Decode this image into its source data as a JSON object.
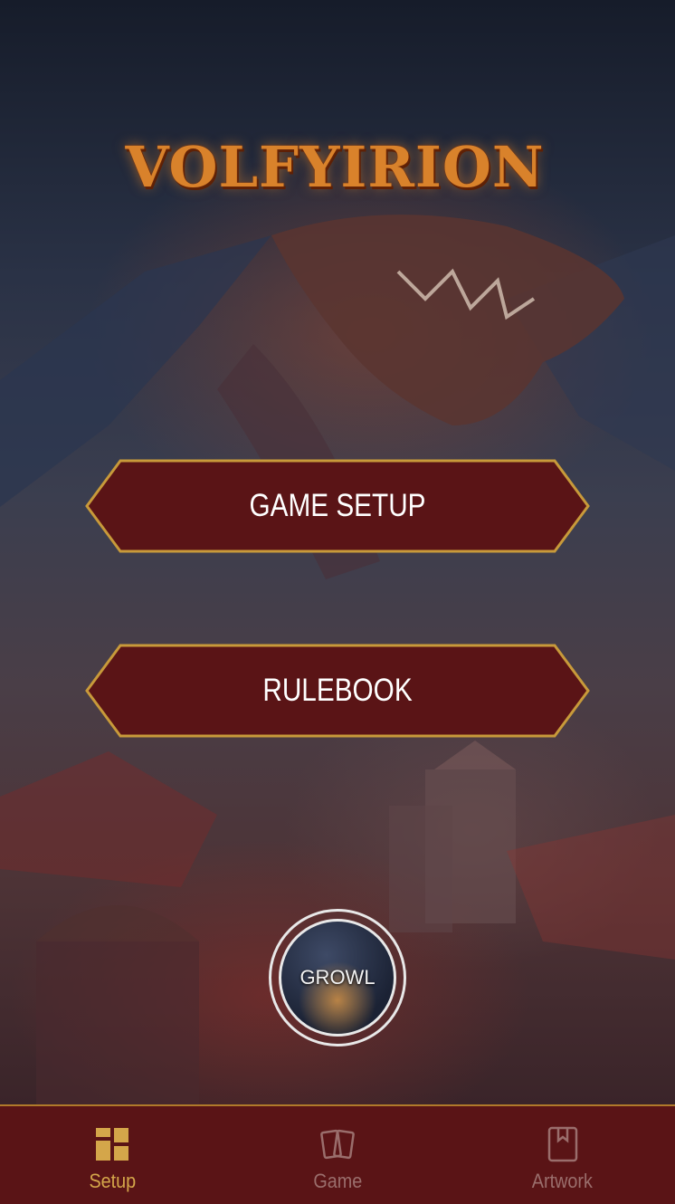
{
  "app": {
    "logo_text": "VOLFYIRION"
  },
  "menu": {
    "game_setup_label": "GAME SETUP",
    "rulebook_label": "RULEBOOK"
  },
  "growl": {
    "label": "GROWL"
  },
  "tabbar": {
    "tabs": [
      {
        "label": "Setup",
        "icon": "grid-icon",
        "active": true
      },
      {
        "label": "Game",
        "icon": "cards-icon",
        "active": false
      },
      {
        "label": "Artwork",
        "icon": "book-icon",
        "active": false
      }
    ]
  },
  "colors": {
    "button_fill": "#5a1416",
    "button_border": "#c89a3a",
    "tab_active": "#d4a64a",
    "tab_inactive": "#9a6e6c"
  }
}
